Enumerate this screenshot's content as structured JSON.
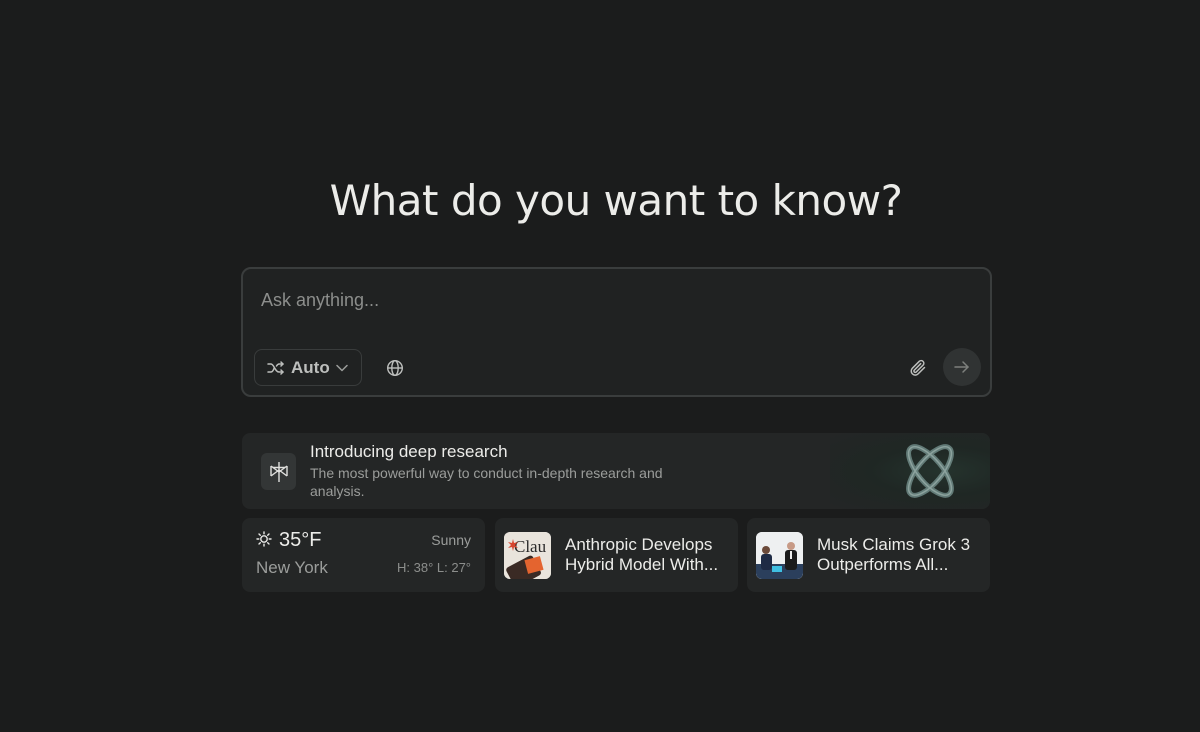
{
  "headline": "What do you want to know?",
  "search": {
    "placeholder": "Ask anything...",
    "mode_label": "Auto",
    "mode_icon": "shuffle-icon",
    "globe_icon": "globe-icon",
    "attach_icon": "paperclip-icon",
    "send_icon": "arrow-right-icon"
  },
  "promo": {
    "title": "Introducing deep research",
    "description": "The most powerful way to conduct in-depth research and analysis.",
    "icon": "perplexity-logo-icon"
  },
  "weather": {
    "temperature": "35°F",
    "condition": "Sunny",
    "city": "New York",
    "high_low": "H: 38° L: 27°",
    "icon": "sun-icon"
  },
  "news": [
    {
      "line1": "Anthropic Develops",
      "line2": "Hybrid Model With..."
    },
    {
      "line1": "Musk Claims Grok 3",
      "line2": "Outperforms All..."
    }
  ],
  "colors": {
    "background": "#1b1c1c",
    "card": "#242626",
    "border": "#3a3d3d"
  }
}
